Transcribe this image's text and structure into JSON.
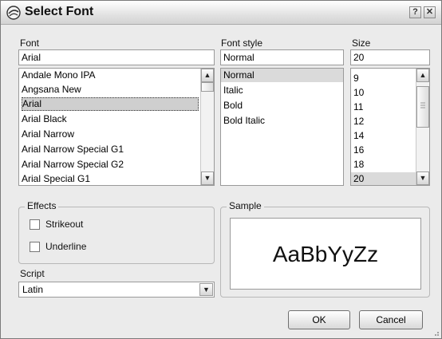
{
  "window": {
    "title": "Select Font"
  },
  "titlebar_buttons": {
    "help": "?",
    "close": "✕"
  },
  "font": {
    "label": "Font",
    "value": "Arial",
    "items": [
      "Andale Mono IPA",
      "Angsana New",
      "Arial",
      "Arial Black",
      "Arial Narrow",
      "Arial Narrow Special G1",
      "Arial Narrow Special G2",
      "Arial Special G1"
    ],
    "selected": "Arial"
  },
  "style": {
    "label": "Font style",
    "value": "Normal",
    "items": [
      "Normal",
      "Italic",
      "Bold",
      "Bold Italic"
    ],
    "selected": "Normal"
  },
  "size": {
    "label": "Size",
    "value": "20",
    "items": [
      "9",
      "10",
      "11",
      "12",
      "14",
      "16",
      "18",
      "20"
    ],
    "selected": "20"
  },
  "effects": {
    "label": "Effects",
    "strikeout": {
      "label": "Strikeout",
      "checked": false
    },
    "underline": {
      "label": "Underline",
      "checked": false
    }
  },
  "sample": {
    "label": "Sample",
    "text": "AaBbYyZz"
  },
  "script": {
    "label": "Script",
    "value": "Latin"
  },
  "buttons": {
    "ok": "OK",
    "cancel": "Cancel"
  },
  "icons": {
    "app": "font-dialog-icon",
    "scroll_up": "▲",
    "scroll_down": "▼",
    "combo_arrow": "▼"
  }
}
